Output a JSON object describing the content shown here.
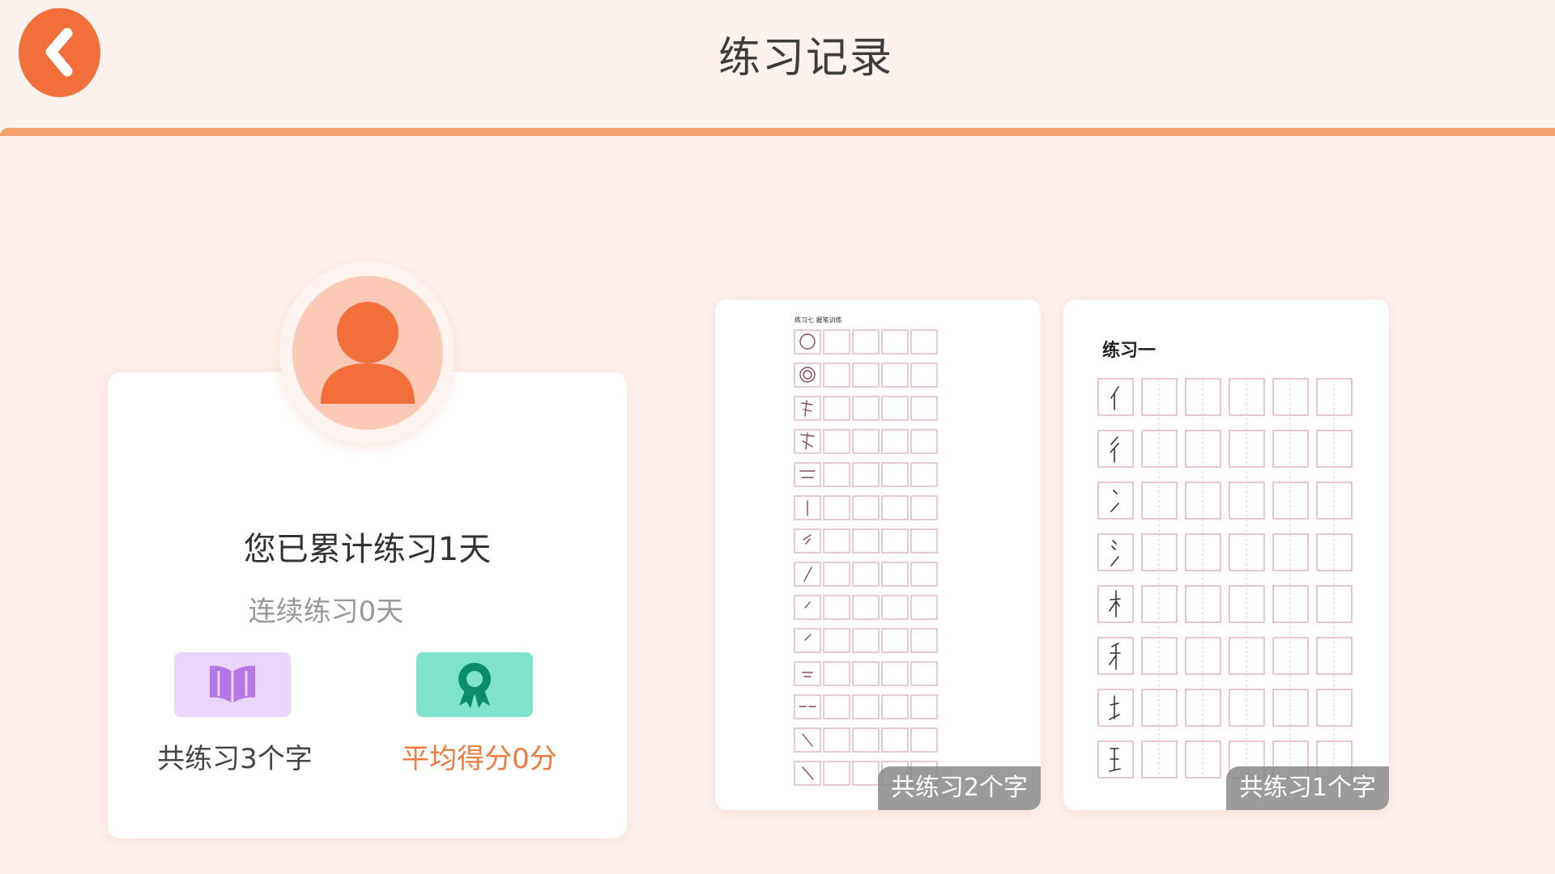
{
  "header": {
    "title": "练习记录",
    "back_icon": "chevron-left-icon"
  },
  "colors": {
    "accent": "#f26e3a",
    "header_rule": "#f4a06d",
    "background": "#fdf0ec",
    "score_text": "#ef7a3b",
    "book_badge": "#ead5fb",
    "award_badge": "#7fe3cb"
  },
  "profile": {
    "avatar_icon": "user-avatar-icon",
    "total_days_text": "您已累计练习1天",
    "streak_text": "连续练习0天",
    "stats": {
      "chars_icon": "book-icon",
      "chars_text": "共练习3个字",
      "score_icon": "award-icon",
      "score_text": "平均得分0分"
    }
  },
  "sheets": [
    {
      "tiny_title": "练习七 握笔训练",
      "count_text": "共练习2个字"
    },
    {
      "heading": "练习一",
      "count_text": "共练习1个字"
    }
  ]
}
